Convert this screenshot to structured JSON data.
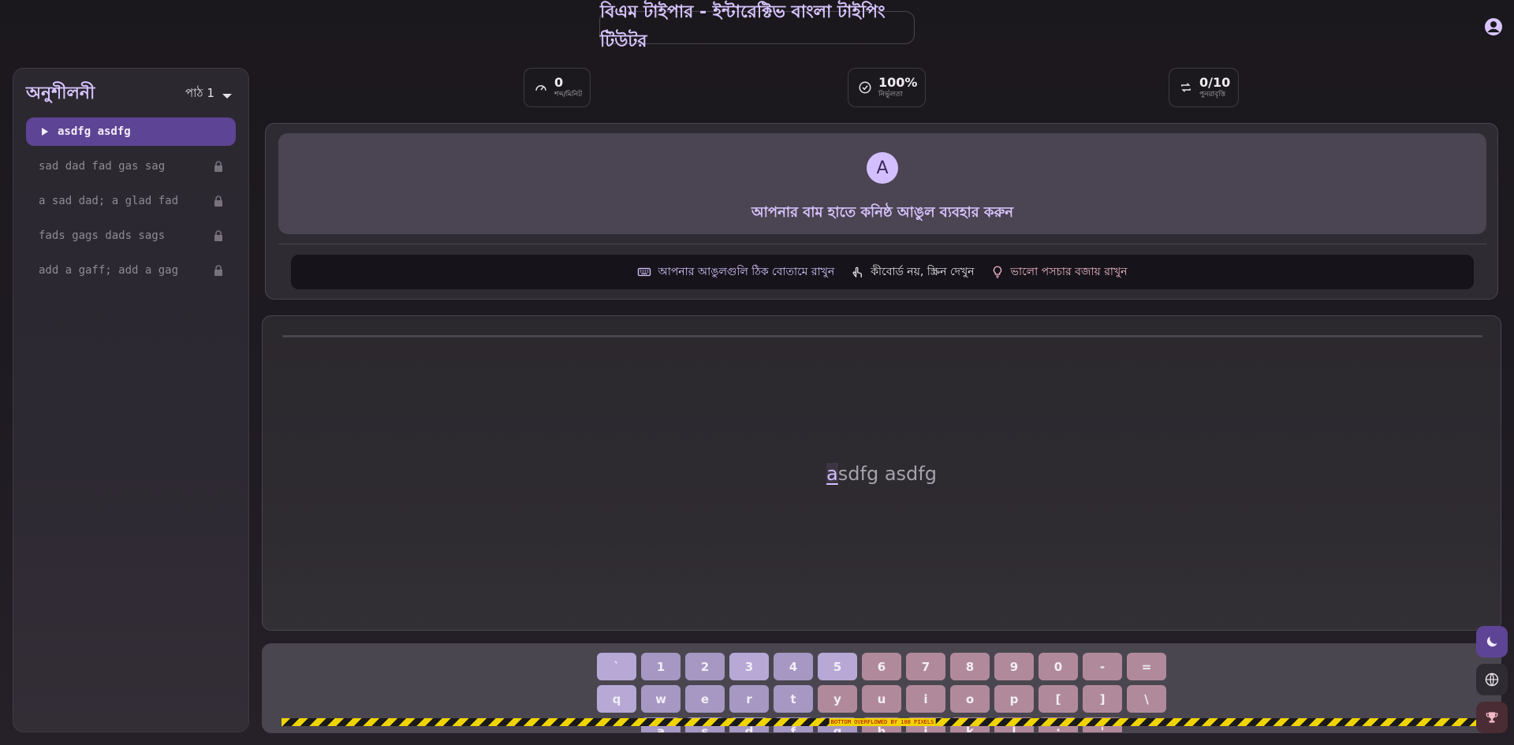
{
  "app": {
    "title": "বিএম টাইপার - ইন্টারেক্টিভ বাংলা টাইপিং টিউটর"
  },
  "sidebar": {
    "title": "অনুশীলনী",
    "lesson_select": "পাঠ 1",
    "items": [
      {
        "label": "asdfg asdfg",
        "active": true,
        "locked": false
      },
      {
        "label": "sad dad fad gas sag",
        "active": false,
        "locked": true
      },
      {
        "label": "a sad dad; a glad fad",
        "active": false,
        "locked": true
      },
      {
        "label": "fads gags dads sags",
        "active": false,
        "locked": true
      },
      {
        "label": "add a gaff; add a gag",
        "active": false,
        "locked": true
      }
    ]
  },
  "stats": {
    "speed": {
      "value": "0",
      "caption": "শব্দ/মিনিট",
      "icon": "speedometer-icon"
    },
    "accuracy": {
      "value": "100%",
      "caption": "নির্ভুলতা",
      "icon": "check-circle-icon"
    },
    "repeat": {
      "value": "0/10",
      "caption": "পুনরাবৃত্তি",
      "icon": "repeat-icon"
    }
  },
  "finger_hint": {
    "letter": "A",
    "instruction": "আপনার বাম হাতে কনিষ্ঠ আঙুল ব্যবহার করুন"
  },
  "tips": [
    {
      "text": "আপনার আঙুলগুলি ঠিক বোতামে রাখুন",
      "icon": "keyboard-icon",
      "color": "#d8c4ff"
    },
    {
      "text": "কীবোর্ড নয়, স্ক্রিন দেখুন",
      "icon": "touch-icon",
      "color": "#e6e1e6"
    },
    {
      "text": "ভালো পসচার বজায় রাখুন",
      "icon": "lightbulb-icon",
      "color": "#f2b8c8"
    }
  ],
  "practice": {
    "current_char": "a",
    "rest": "sdfg asdfg"
  },
  "keyboard": {
    "row1": [
      "`",
      "1",
      "2",
      "3",
      "4",
      "5",
      "6",
      "7",
      "8",
      "9",
      "0",
      "-",
      "="
    ],
    "row2": [
      "q",
      "w",
      "e",
      "r",
      "t",
      "y",
      "u",
      "i",
      "o",
      "p",
      "[",
      "]",
      "\\"
    ],
    "row3": [
      "a",
      "s",
      "d",
      "f",
      "g",
      "h",
      "j",
      "k",
      "l",
      ";",
      "'"
    ]
  },
  "overflow_banner": "BOTTOM OVERFLOWED BY 108 PIXELS",
  "colors": {
    "accent": "#d8c4ff",
    "active_item": "#5e4494",
    "left_hand_key": "#a697c3",
    "right_hand_key": "#b08a9b"
  }
}
